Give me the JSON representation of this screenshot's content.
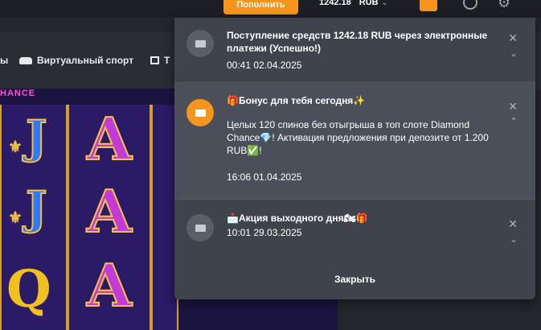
{
  "header": {
    "deposit_label": "Пополнить",
    "balance": "1242.18",
    "currency": "RUB",
    "accent_color": "#f7941d"
  },
  "nav": {
    "items": [
      {
        "label": "ы",
        "icon": ""
      },
      {
        "label": "Виртуальный спорт",
        "icon": "car-icon"
      },
      {
        "label": "Т",
        "icon": "tv-icon"
      }
    ]
  },
  "game": {
    "title_fragment": "HANCE"
  },
  "notifications": {
    "items": [
      {
        "icon": "envelope-icon",
        "title": "Поступление средств 1242.18 RUB через электронные платежи (Успешно!)",
        "body": "",
        "time": "00:41 02.04.2025",
        "expanded": false
      },
      {
        "icon": "envelope-open-icon",
        "title": "🎁Бонус для тебя сегодня✨",
        "body": "Целых 120 спинов без отыгрыша в топ слоте Diamond Chance💎! Активация предложения при депозите от 1.200 RUB✅!",
        "time": "16:06 01.04.2025",
        "expanded": true
      },
      {
        "icon": "envelope-open-icon",
        "title": "📩Акция выходного дня🏍🎁",
        "body": "",
        "time": "10:01 29.03.2025",
        "expanded": false
      }
    ],
    "close_label": "Закрыть"
  }
}
